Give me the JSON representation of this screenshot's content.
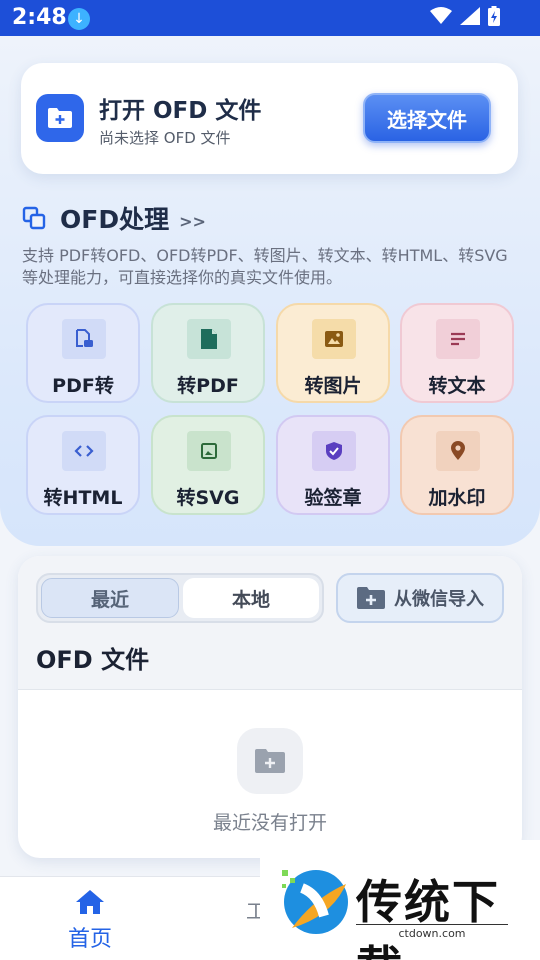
{
  "status_bar": {
    "time": "2:48",
    "download_icon": "download-icon",
    "wifi_icon": "wifi-icon",
    "signal_icon": "signal-icon",
    "battery_icon": "battery-charging-icon"
  },
  "open_card": {
    "title": "打开 OFD 文件",
    "subtitle": "尚未选择 OFD 文件",
    "button_label": "选择文件",
    "icon": "folder-plus-icon"
  },
  "ofd_section": {
    "title": "OFD处理",
    "more": ">>",
    "description": "支持 PDF转OFD、OFD转PDF、转图片、转文本、转HTML、转SVG 等处理能力，可直接选择你的真实文件使用。",
    "tools": [
      {
        "label": "PDF转",
        "icon": "pdf-convert-icon",
        "color": "#3a5fd0"
      },
      {
        "label": "转PDF",
        "icon": "file-pdf-icon",
        "color": "#1f6d5c"
      },
      {
        "label": "转图片",
        "icon": "image-icon",
        "color": "#8a5a12"
      },
      {
        "label": "转文本",
        "icon": "text-icon",
        "color": "#9b3a55"
      },
      {
        "label": "转HTML",
        "icon": "code-icon",
        "color": "#3a5fd0"
      },
      {
        "label": "转SVG",
        "icon": "svg-icon",
        "color": "#2d6a3a"
      },
      {
        "label": "验签章",
        "icon": "shield-check-icon",
        "color": "#5a3fc0"
      },
      {
        "label": "加水印",
        "icon": "location-pin-icon",
        "color": "#8a4a25"
      }
    ]
  },
  "files": {
    "tabs": [
      "最近",
      "本地"
    ],
    "active_tab": "最近",
    "wechat_import": "从微信导入",
    "title": "OFD 文件",
    "empty_text": "最近没有打开"
  },
  "bottom_nav": {
    "home_label": "首页",
    "second_label": "工"
  },
  "watermark": {
    "text": "传统下载",
    "url": "ctdown.com"
  }
}
